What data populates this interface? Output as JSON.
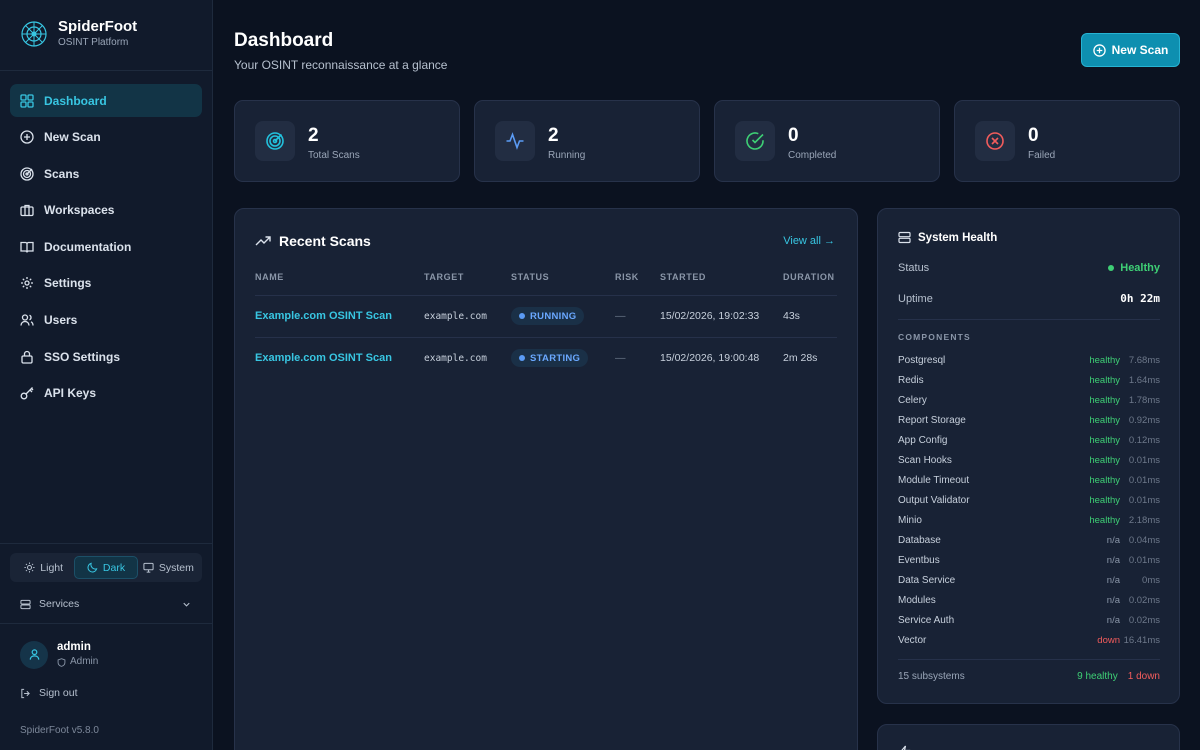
{
  "brand": {
    "title": "SpiderFoot",
    "subtitle": "OSINT Platform"
  },
  "nav": [
    {
      "label": "Dashboard",
      "icon": "dashboard-icon",
      "active": true
    },
    {
      "label": "New Scan",
      "icon": "plus-circle-icon"
    },
    {
      "label": "Scans",
      "icon": "radar-icon"
    },
    {
      "label": "Workspaces",
      "icon": "briefcase-icon"
    },
    {
      "label": "Documentation",
      "icon": "book-icon"
    },
    {
      "label": "Settings",
      "icon": "gear-icon"
    },
    {
      "label": "Users",
      "icon": "users-icon"
    },
    {
      "label": "SSO Settings",
      "icon": "lock-icon"
    },
    {
      "label": "API Keys",
      "icon": "key-icon"
    }
  ],
  "theme": {
    "light": "Light",
    "dark": "Dark",
    "system": "System",
    "selected": "Dark"
  },
  "services_label": "Services",
  "user": {
    "name": "admin",
    "role": "Admin"
  },
  "signout": "Sign out",
  "version": "SpiderFoot v5.8.0",
  "header": {
    "title": "Dashboard",
    "subtitle": "Your OSINT reconnaissance at a glance",
    "new_scan": "New Scan"
  },
  "stats": [
    {
      "value": "2",
      "label": "Total Scans",
      "icon": "radar-icon",
      "color": "#22c1dd"
    },
    {
      "value": "2",
      "label": "Running",
      "icon": "activity-icon",
      "color": "#5b9bf4"
    },
    {
      "value": "0",
      "label": "Completed",
      "icon": "check-circle-icon",
      "color": "#3ecf75"
    },
    {
      "value": "0",
      "label": "Failed",
      "icon": "x-circle-icon",
      "color": "#f25c5c"
    }
  ],
  "recent": {
    "title": "Recent Scans",
    "view_all": "View all →",
    "columns": [
      "NAME",
      "TARGET",
      "STATUS",
      "RISK",
      "STARTED",
      "DURATION"
    ],
    "rows": [
      {
        "name": "Example.com OSINT Scan",
        "target": "example.com",
        "status": "RUNNING",
        "risk": "—",
        "started": "15/02/2026, 19:02:33",
        "duration": "43s"
      },
      {
        "name": "Example.com OSINT Scan",
        "target": "example.com",
        "status": "STARTING",
        "risk": "—",
        "started": "15/02/2026, 19:00:48",
        "duration": "2m 28s"
      }
    ]
  },
  "health": {
    "title": "System Health",
    "status_label": "Status",
    "status_value": "Healthy",
    "uptime_label": "Uptime",
    "uptime_value": "0h 22m",
    "components_label": "COMPONENTS",
    "components": [
      {
        "name": "Postgresql",
        "status": "healthy",
        "ms": "7.68ms"
      },
      {
        "name": "Redis",
        "status": "healthy",
        "ms": "1.64ms"
      },
      {
        "name": "Celery",
        "status": "healthy",
        "ms": "1.78ms"
      },
      {
        "name": "Report Storage",
        "status": "healthy",
        "ms": "0.92ms"
      },
      {
        "name": "App Config",
        "status": "healthy",
        "ms": "0.12ms"
      },
      {
        "name": "Scan Hooks",
        "status": "healthy",
        "ms": "0.01ms"
      },
      {
        "name": "Module Timeout",
        "status": "healthy",
        "ms": "0.01ms"
      },
      {
        "name": "Output Validator",
        "status": "healthy",
        "ms": "0.01ms"
      },
      {
        "name": "Minio",
        "status": "healthy",
        "ms": "2.18ms"
      },
      {
        "name": "Database",
        "status": "n/a",
        "ms": "0.04ms"
      },
      {
        "name": "Eventbus",
        "status": "n/a",
        "ms": "0.01ms"
      },
      {
        "name": "Data Service",
        "status": "n/a",
        "ms": "0ms"
      },
      {
        "name": "Modules",
        "status": "n/a",
        "ms": "0.02ms"
      },
      {
        "name": "Service Auth",
        "status": "n/a",
        "ms": "0.02ms"
      },
      {
        "name": "Vector",
        "status": "down",
        "ms": "16.41ms"
      }
    ],
    "footer_total": "15 subsystems",
    "footer_healthy": "9 healthy",
    "footer_down": "1 down"
  }
}
